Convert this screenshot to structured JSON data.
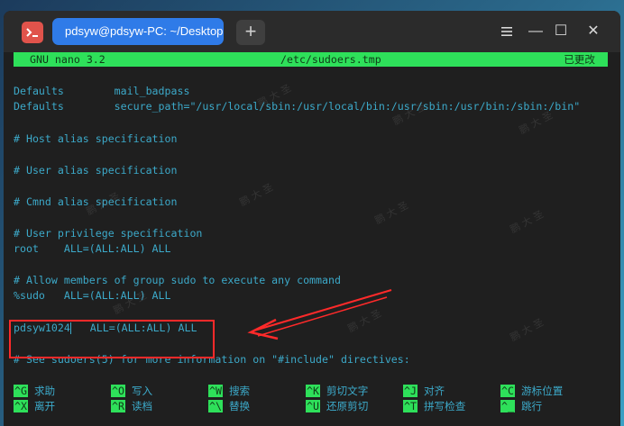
{
  "window": {
    "tab_title": "pdsyw@pdsyw-PC: ~/Desktop",
    "new_tab_symbol": "+",
    "minimize_symbol": "—",
    "maximize_symbol": "☐",
    "close_symbol": "✕"
  },
  "editor": {
    "app_name": "GNU nano 3.2",
    "filename": "/etc/sudoers.tmp",
    "status": "已更改"
  },
  "lines": [
    "Defaults        mail_badpass",
    "Defaults        secure_path=\"/usr/local/sbin:/usr/local/bin:/usr/sbin:/usr/bin:/sbin:/bin\"",
    "# Host alias specification",
    "# User alias specification",
    "# Cmnd alias specification",
    "# User privilege specification",
    "root    ALL=(ALL:ALL) ALL",
    "# Allow members of group sudo to execute any command",
    "%sudo   ALL=(ALL:ALL) ALL",
    "pdsyw1024",
    "   ALL=(ALL:ALL) ALL",
    "# See sudoers(5) for more information on \"#include\" directives:"
  ],
  "shortcuts": [
    {
      "key": "^G",
      "label": "求助"
    },
    {
      "key": "^O",
      "label": "写入"
    },
    {
      "key": "^W",
      "label": "搜索"
    },
    {
      "key": "^K",
      "label": "剪切文字"
    },
    {
      "key": "^J",
      "label": "对齐"
    },
    {
      "key": "^C",
      "label": "游标位置"
    },
    {
      "key": "^X",
      "label": "离开"
    },
    {
      "key": "^R",
      "label": "读档"
    },
    {
      "key": "^\\",
      "label": "替换"
    },
    {
      "key": "^U",
      "label": "还原剪切"
    },
    {
      "key": "^T",
      "label": "拼写检查"
    },
    {
      "key": "^_",
      "label": "跳行"
    }
  ],
  "watermark_text": "鹏 大 圣",
  "colors": {
    "accent": "#2f7be8",
    "nano_green": "#2ee05a",
    "text_cyan": "#3ca9c9",
    "annotation_red": "#ff2a2a"
  }
}
